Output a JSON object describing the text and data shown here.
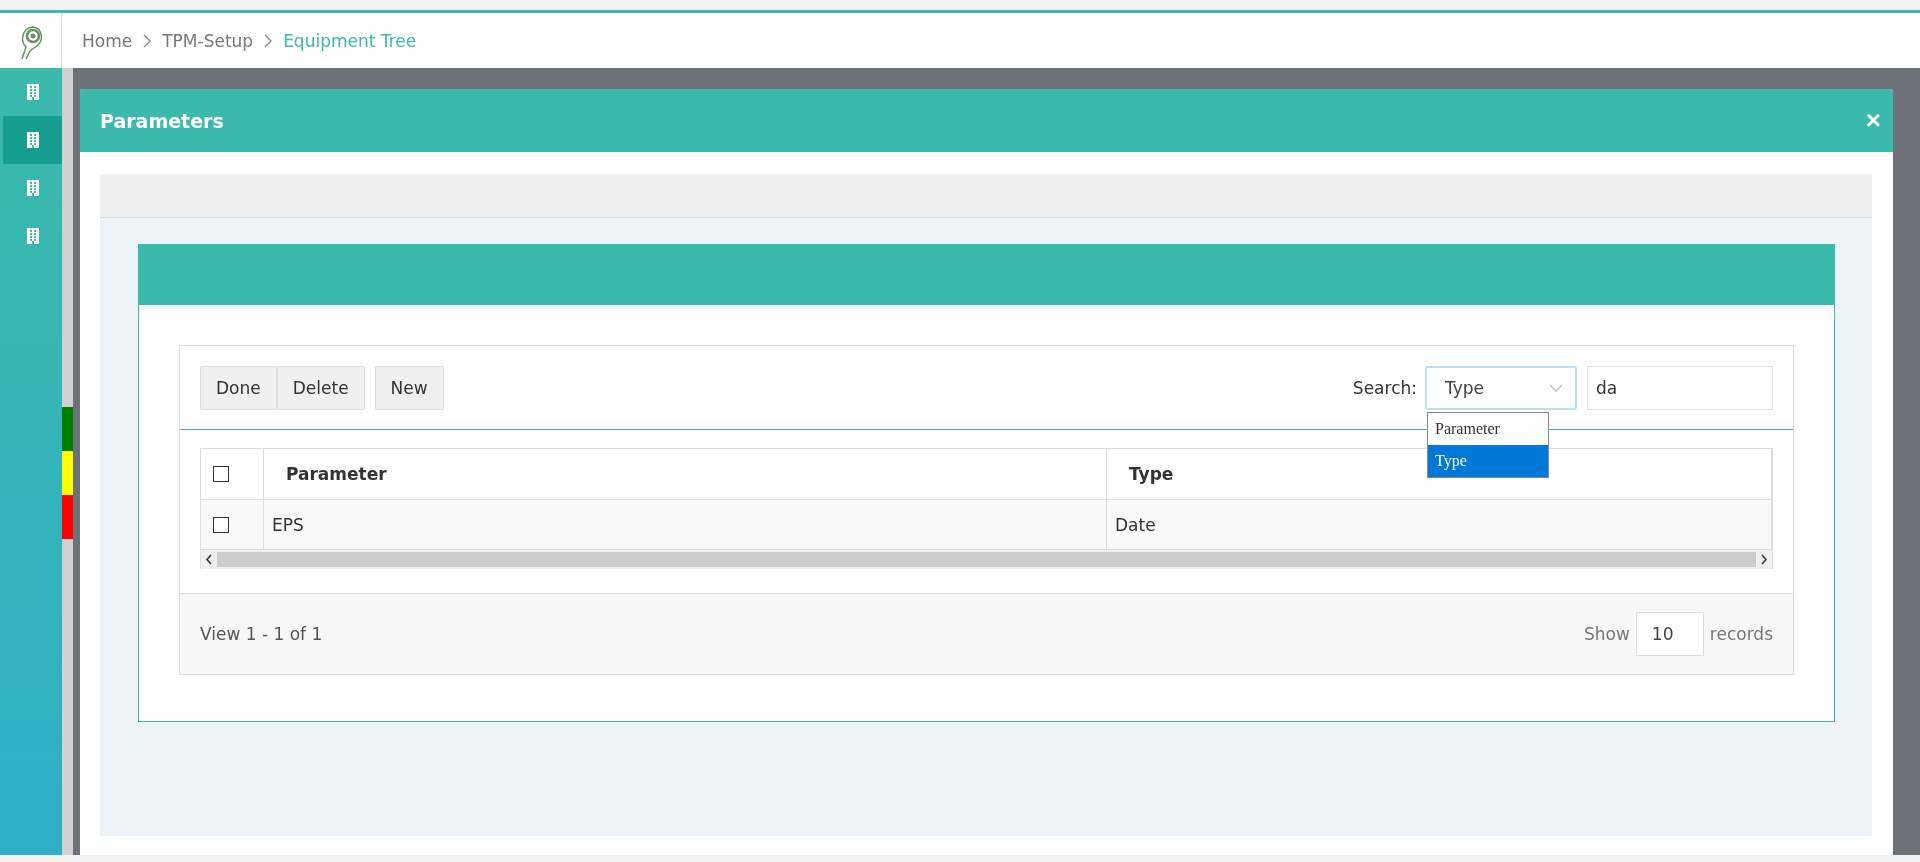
{
  "breadcrumb": [
    {
      "label": "Home",
      "selected": false
    },
    {
      "label": "TPM-Setup",
      "selected": false
    },
    {
      "label": "Equipment Tree",
      "selected": true
    }
  ],
  "sidebar": {
    "items": [
      {
        "selected": false
      },
      {
        "selected": true
      },
      {
        "selected": false
      },
      {
        "selected": false
      }
    ]
  },
  "status_segments": [
    {
      "color": "#008000"
    },
    {
      "color": "#ffff00"
    },
    {
      "color": "#ff0000"
    }
  ],
  "modal": {
    "title": "Parameters",
    "close": "×",
    "toolbar": {
      "buttons": [
        "Done",
        "Delete",
        "New"
      ]
    },
    "search": {
      "label": "Search:",
      "field": {
        "value": "Type",
        "expanded": true,
        "options": [
          {
            "label": "Parameter",
            "selected": false
          },
          {
            "label": "Type",
            "selected": true
          }
        ]
      },
      "query": "da"
    },
    "table": {
      "columns": [
        "Parameter",
        "Type"
      ],
      "header_checked": false,
      "rows": [
        {
          "checked": false,
          "cells": [
            "EPS",
            "Date"
          ]
        }
      ]
    },
    "footer": {
      "view": "View 1 - 1 of 1",
      "show_label": "Show",
      "page_size": "10",
      "records_label": "records"
    }
  }
}
